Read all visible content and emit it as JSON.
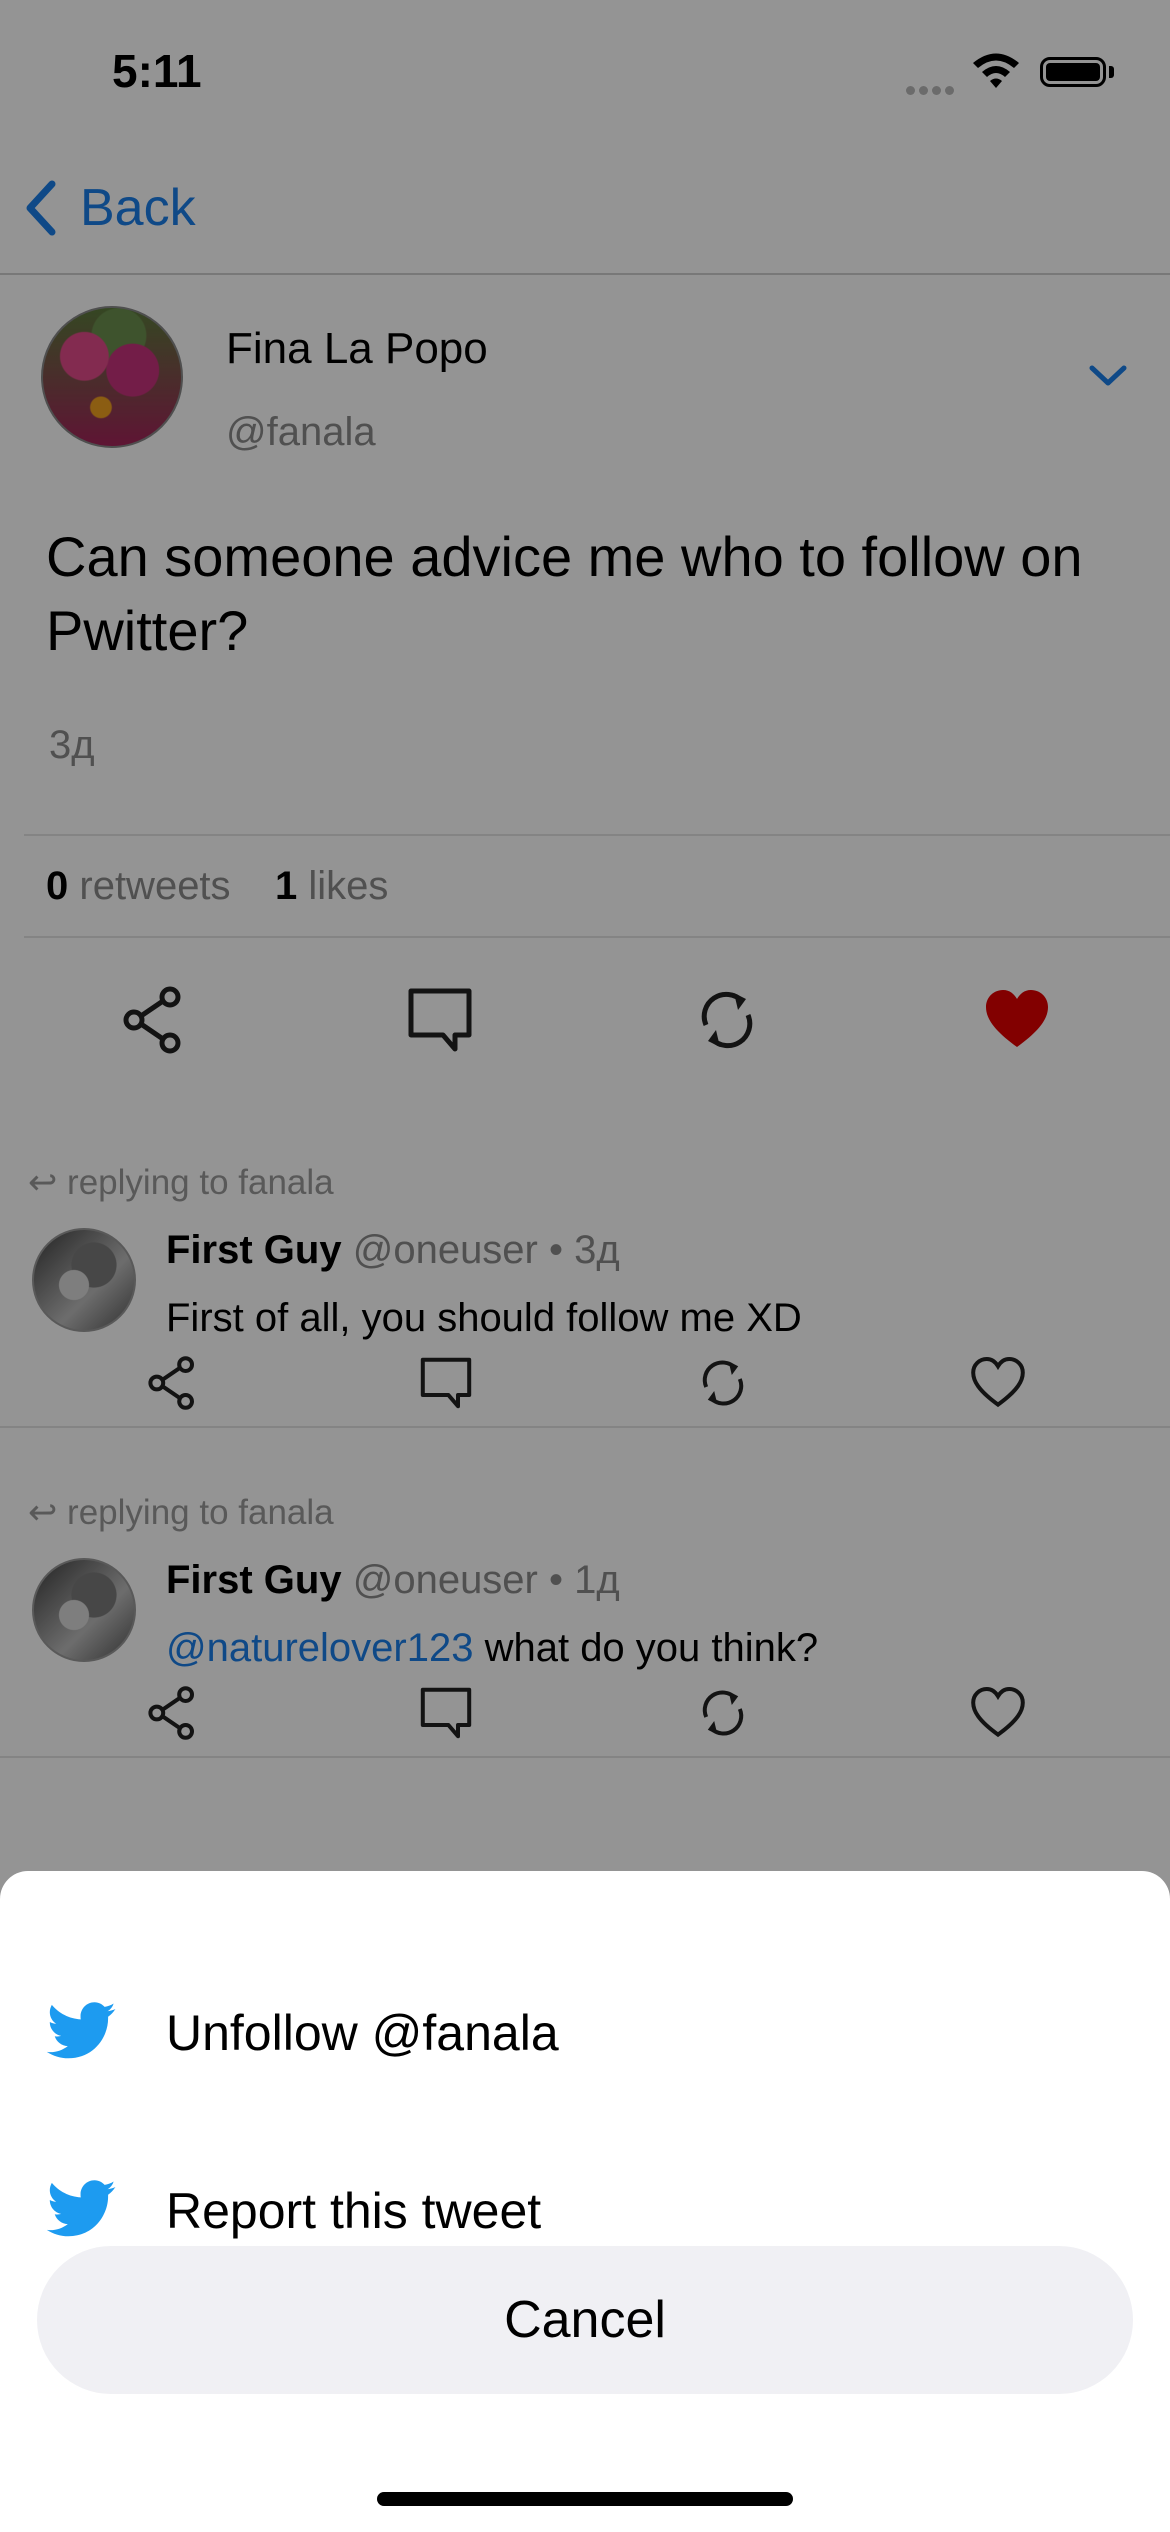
{
  "status_bar": {
    "time": "5:11"
  },
  "nav": {
    "back_label": "Back"
  },
  "tweet": {
    "author_name": "Fina La Popo",
    "author_handle": "@fanala",
    "text": "Can someone advice me who to follow on Pwitter?",
    "time_ago": "3д",
    "retweets_count": "0",
    "retweets_label": "retweets",
    "likes_count": "1",
    "likes_label": "likes",
    "liked": true
  },
  "replies": [
    {
      "replying_to": "↩ replying to fanala",
      "name": "First Guy",
      "handle": "@oneuser",
      "dot": "•",
      "time": "3д",
      "mention": "",
      "text": "First of all, you should follow me XD"
    },
    {
      "replying_to": "↩ replying to fanala",
      "name": "First Guy",
      "handle": "@oneuser",
      "dot": "•",
      "time": "1д",
      "mention": "@naturelover123",
      "text": " what do you think?"
    }
  ],
  "action_sheet": {
    "items": [
      {
        "label": "Unfollow @fanala",
        "icon": "twitter-bird-icon"
      },
      {
        "label": "Report this tweet",
        "icon": "twitter-bird-icon"
      }
    ],
    "cancel_label": "Cancel"
  },
  "colors": {
    "accent": "#1a7fe8",
    "like_red": "#e00000",
    "twitter_blue": "#1d9bf0",
    "overlay": "rgba(0,0,0,0.42)"
  }
}
